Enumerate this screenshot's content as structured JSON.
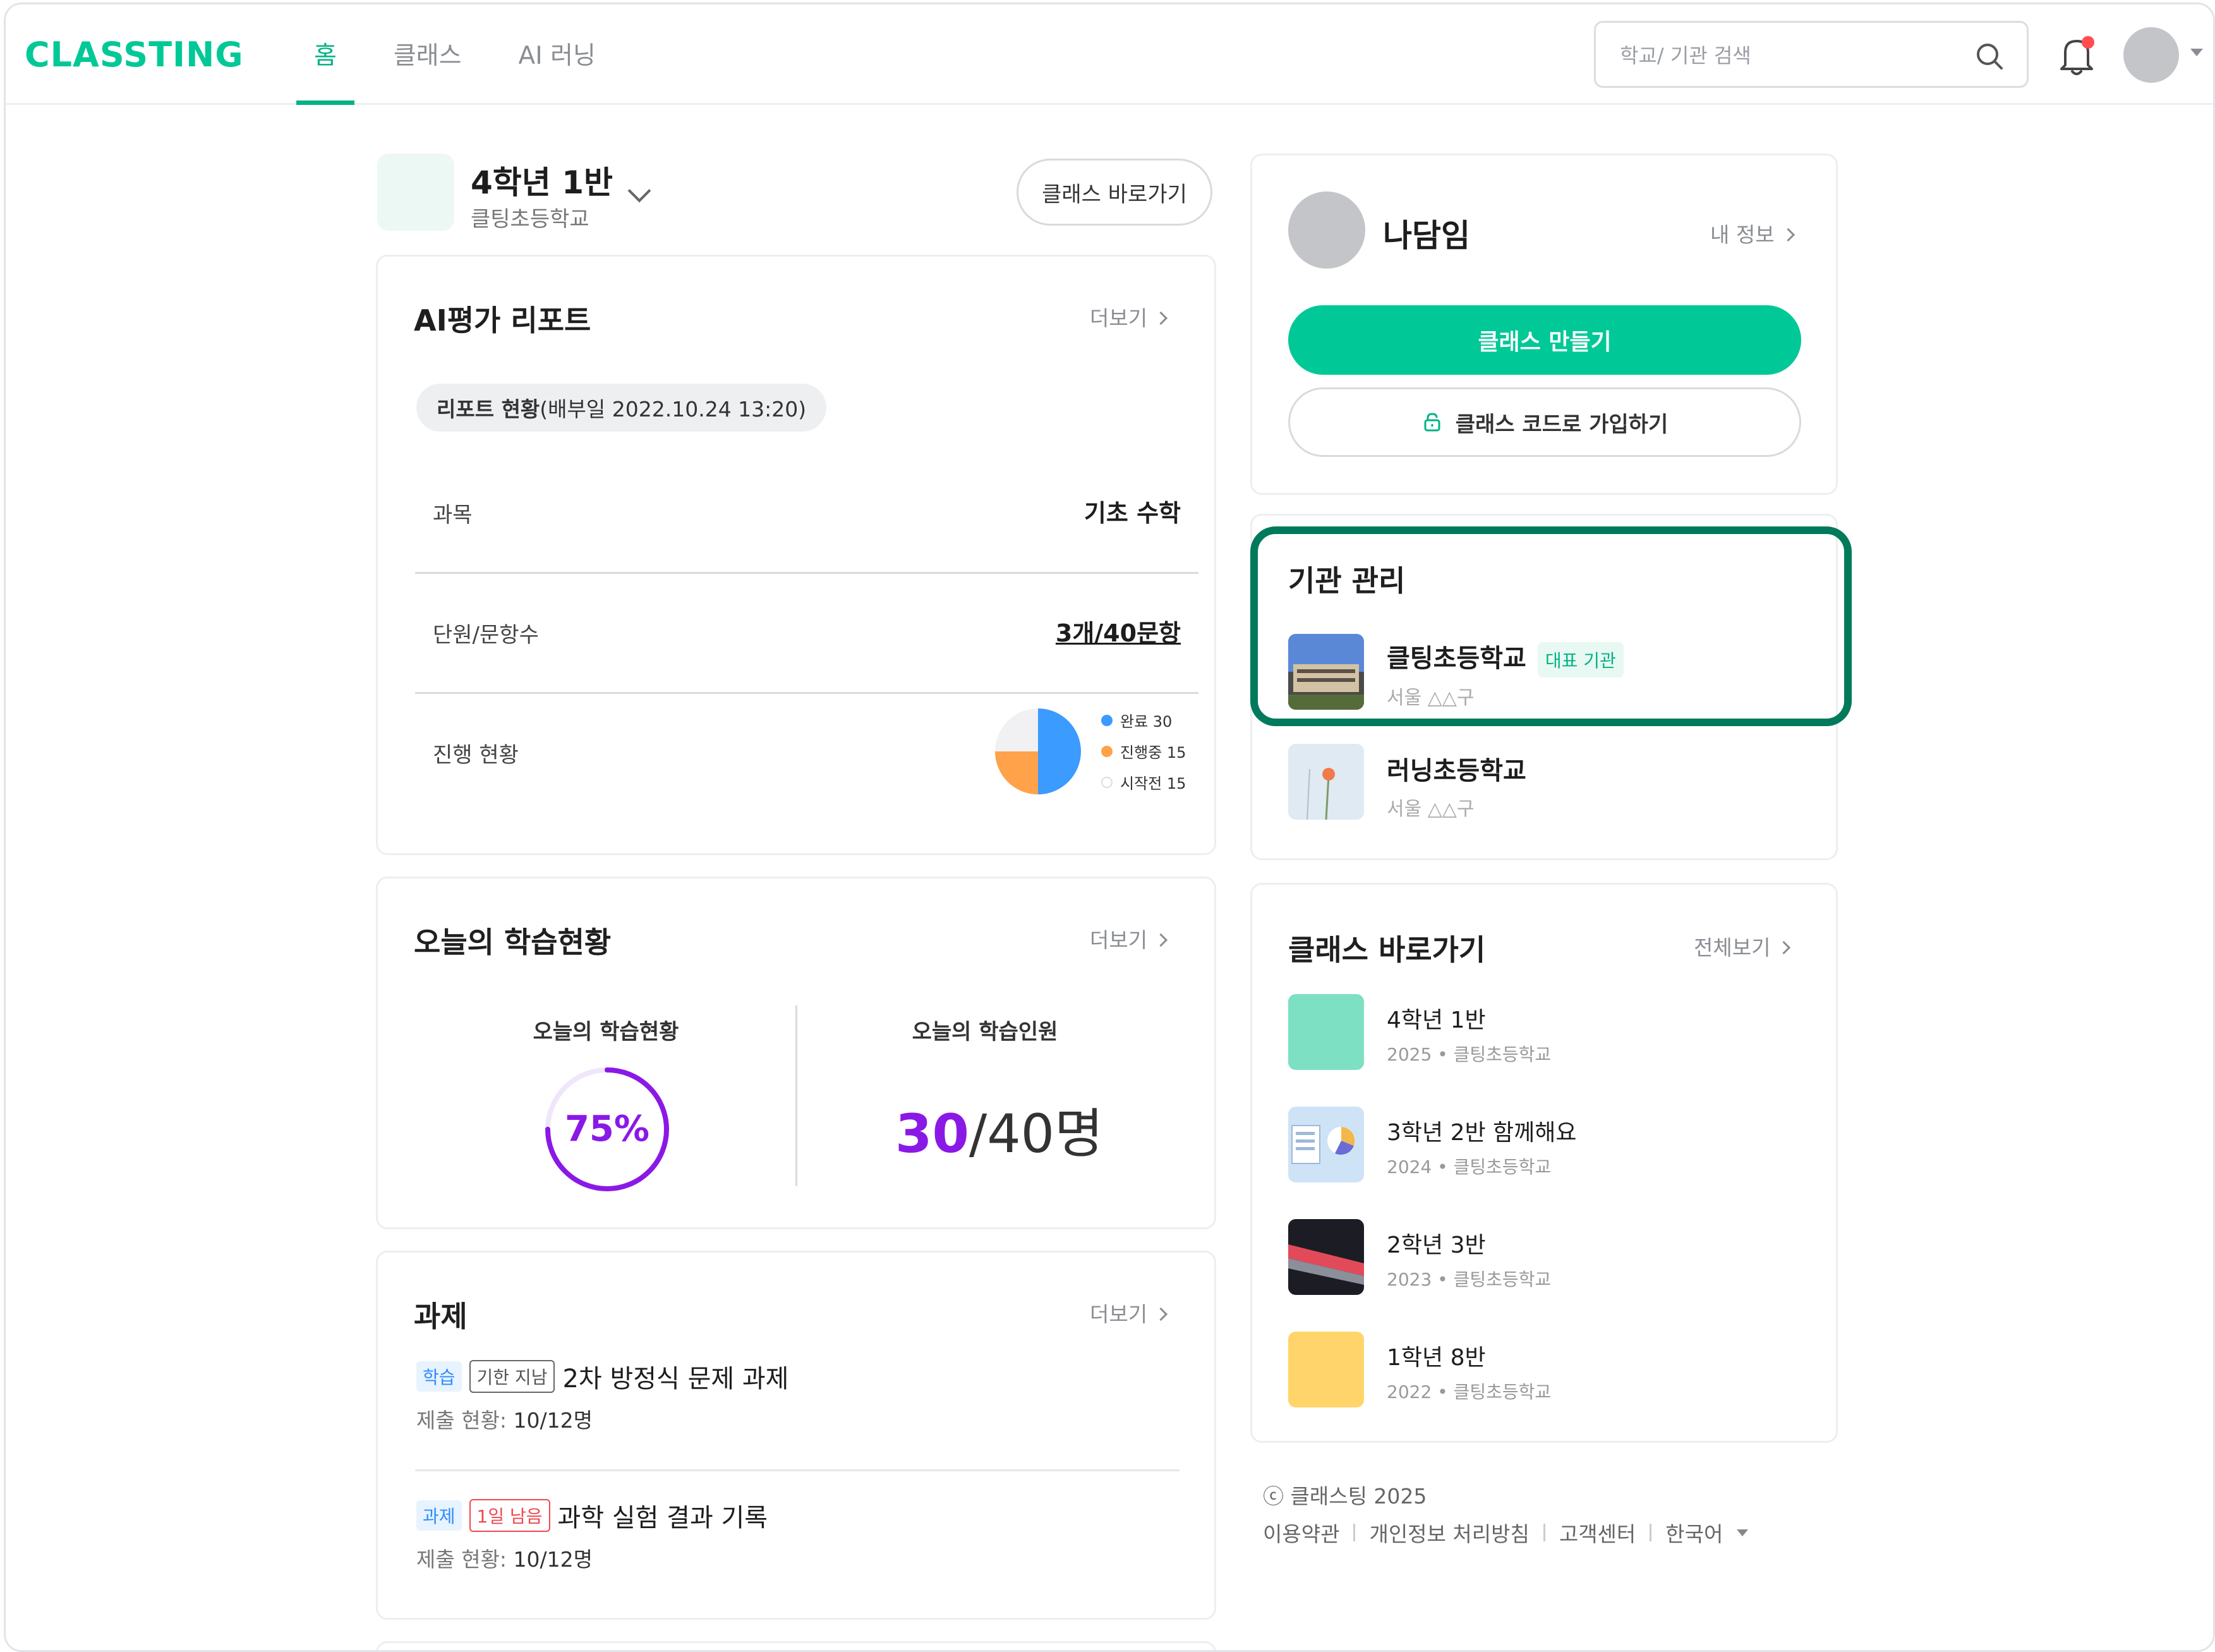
{
  "header": {
    "logo": "CLASSTING",
    "nav": [
      "홈",
      "클래스",
      "AI 러닝"
    ],
    "search_placeholder": "학교/ 기관 검색"
  },
  "class_header": {
    "name": "4학년 1반",
    "school": "클팅초등학교",
    "shortcut_button": "클래스 바로가기"
  },
  "ai_report": {
    "title": "AI평가 리포트",
    "more": "더보기",
    "status_bold": "리포트 현황",
    "status_rest": "(배부일 2022.10.24 13:20)",
    "rows": [
      {
        "label": "과목",
        "value": "기초 수학"
      },
      {
        "label": "단원/문항수",
        "value": "3개/40문항"
      },
      {
        "label": "진행 현황",
        "value": ""
      }
    ],
    "legend": [
      {
        "label": "완료 30",
        "color": "#3b9bff"
      },
      {
        "label": "진행중 15",
        "color": "#ffa24a"
      },
      {
        "label": "시작전 15",
        "color": "#f1f1f3"
      }
    ]
  },
  "chart_data": {
    "type": "pie",
    "categories": [
      "완료",
      "진행중",
      "시작전"
    ],
    "values": [
      30,
      15,
      15
    ],
    "colors": [
      "#3b9bff",
      "#ffa24a",
      "#f1f1f3"
    ]
  },
  "today": {
    "title": "오늘의 학습현황",
    "more": "더보기",
    "status_label": "오늘의 학습현황",
    "percent_text": "75%",
    "percent_value": 75,
    "people_label": "오늘의 학습인원",
    "people_current": "30",
    "people_rest": "/40명"
  },
  "assignments": {
    "title": "과제",
    "more": "더보기",
    "items": [
      {
        "tag": "학습",
        "status": "기한 지남",
        "title": "2차 방정식 문제 과제",
        "sub_label": "제출 현황: ",
        "sub_value": "10/12명"
      },
      {
        "tag": "과제",
        "status": "1일 남음",
        "title": "과학 실험 결과 기록",
        "sub_label": "제출 현황: ",
        "sub_value": "10/12명"
      }
    ]
  },
  "profile": {
    "name": "나담임",
    "my_info": "내 정보",
    "create_class": "클래스 만들기",
    "join_code": "클래스 코드로 가입하기"
  },
  "institution": {
    "title": "기관 관리",
    "items": [
      {
        "name": "클팅초등학교",
        "badge": "대표 기관",
        "address": "서울 △△구"
      },
      {
        "name": "러닝초등학교",
        "badge": "",
        "address": "서울 △△구"
      }
    ]
  },
  "quick_classes": {
    "title": "클래스 바로가기",
    "view_all": "전체보기",
    "items": [
      {
        "name": "4학년 1반",
        "year": "2025",
        "school": "클팅초등학교",
        "color": "#7de0c3"
      },
      {
        "name": "3학년 2반 함께해요",
        "year": "2024",
        "school": "클팅초등학교",
        "color": "#cfe3f7"
      },
      {
        "name": "2학년 3반",
        "year": "2023",
        "school": "클팅초등학교",
        "color": "#2b2b33"
      },
      {
        "name": "1학년 8반",
        "year": "2022",
        "school": "클팅초등학교",
        "color": "#ffd56b"
      }
    ]
  },
  "footer": {
    "copyright": "ⓒ 클래스팅 2025",
    "links": [
      "이용약관",
      "개인정보 처리방침",
      "고객센터",
      "한국어"
    ]
  }
}
